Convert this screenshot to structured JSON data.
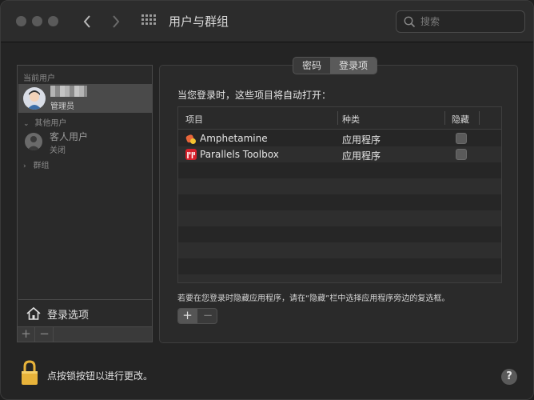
{
  "window": {
    "title": "用户与群组"
  },
  "search": {
    "placeholder": "搜索"
  },
  "sidebar": {
    "current_users_label": "当前用户",
    "current_user": {
      "role": "管理员"
    },
    "other_users_label": "其他用户",
    "guest": {
      "name": "客人用户",
      "status": "关闭"
    },
    "groups_label": "群组",
    "login_options_label": "登录选项",
    "add_label": "+",
    "remove_label": "−"
  },
  "tabs": [
    {
      "label": "密码",
      "active": false
    },
    {
      "label": "登录项",
      "active": true
    }
  ],
  "panel": {
    "heading": "当您登录时，这些项目将自动打开：",
    "columns": {
      "item": "项目",
      "kind": "种类",
      "hide": "隐藏"
    },
    "rows": [
      {
        "name": "Amphetamine",
        "kind": "应用程序",
        "hidden": false
      },
      {
        "name": "Parallels Toolbox",
        "kind": "应用程序",
        "hidden": false
      }
    ],
    "hint": "若要在您登录时隐藏应用程序，请在“隐藏”栏中选择应用程序旁边的复选框。",
    "add_label": "+",
    "remove_label": "−"
  },
  "footer": {
    "lock_text": "点按锁按钮以进行更改。",
    "help_label": "?"
  },
  "colors": {
    "lock_gold": "#e8b33a",
    "parallels_red": "#d6202a"
  }
}
